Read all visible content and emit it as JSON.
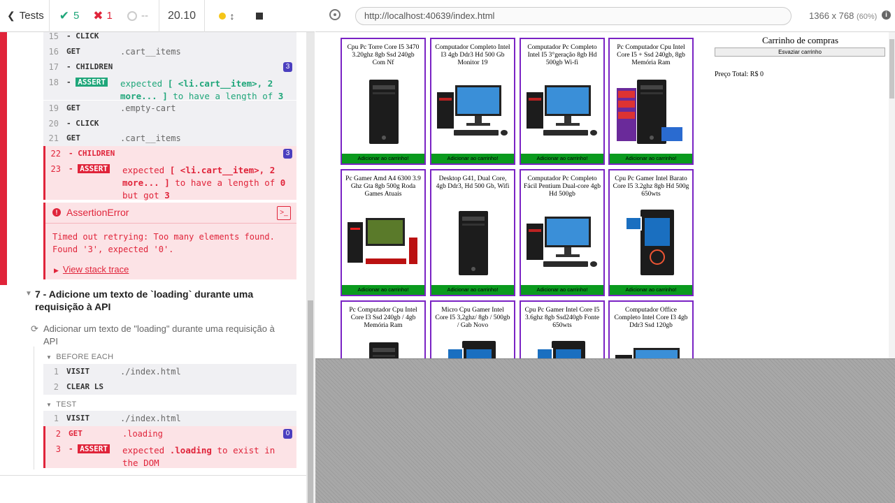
{
  "reporter": {
    "tests_label": "Tests",
    "passed": "5",
    "failed": "1",
    "pending": "--",
    "duration": "20.10"
  },
  "commands": [
    {
      "n": "15",
      "cmd": "- CLICK",
      "arg": ""
    },
    {
      "n": "16",
      "cmd": "GET",
      "arg": ".cart__items"
    },
    {
      "n": "17",
      "cmd": "- CHILDREN",
      "arg": "",
      "badge": "3"
    },
    {
      "n": "18",
      "cmd": "- ASSERT",
      "msg_pre": "expected",
      "msg_b": "[ <li.cart__item>, 2 more... ]",
      "msg_mid": "to have a length of",
      "msg_val": "3"
    },
    {
      "n": "19",
      "cmd": "GET",
      "arg": ".empty-cart"
    },
    {
      "n": "20",
      "cmd": "- CLICK",
      "arg": ""
    },
    {
      "n": "21",
      "cmd": "GET",
      "arg": ".cart__items"
    },
    {
      "n": "22",
      "cmd": "- CHILDREN",
      "arg": "",
      "badge": "3"
    },
    {
      "n": "23",
      "cmd": "- ASSERT",
      "msg_pre": "expected",
      "msg_b": "[ <li.cart__item>, 2 more... ]",
      "msg_mid": "to have a length of",
      "msg_val": "0",
      "msg_tail": "but got",
      "msg_got": "3"
    }
  ],
  "error": {
    "title": "AssertionError",
    "text": "Timed out retrying: Too many elements found. Found '3', expected '0'.",
    "stack_link": "View stack trace"
  },
  "suite7": {
    "title": "7 - Adicione um texto de `loading` durante uma requisição à API",
    "test": "Adicionar um texto de \"loading\" durante uma requisição à API",
    "before_each": "BEFORE EACH",
    "test_label": "TEST",
    "before": [
      {
        "n": "1",
        "cmd": "VISIT",
        "arg": "./index.html"
      },
      {
        "n": "2",
        "cmd": "CLEAR LS",
        "arg": ""
      }
    ],
    "steps": [
      {
        "n": "1",
        "cmd": "VISIT",
        "arg": "./index.html"
      },
      {
        "n": "2",
        "cmd": "GET",
        "arg": ".loading",
        "badge": "0"
      },
      {
        "n": "3",
        "cmd": "- ASSERT",
        "msg_pre": "expected",
        "msg_b": ".loading",
        "msg_mid": "to exist in the DOM"
      }
    ]
  },
  "browser": {
    "url": "http://localhost:40639/index.html",
    "viewport": "1366 x 768",
    "zoom": "(60%)"
  },
  "products": [
    {
      "title": "Cpu Pc Torre Core I5 3470 3.20ghz 8gb Ssd 240gb Com Nf",
      "icon": "tower"
    },
    {
      "title": "Computador Completo Intel I3 4gb Ddr3 Hd 500 Gb Monitor 19",
      "icon": "desktop-set"
    },
    {
      "title": "Computador Pc Completo Intel I5 3°geração 8gb Hd 500gb Wi-fi",
      "icon": "desktop-set"
    },
    {
      "title": "Pc Computador Cpu Intel Core I5 + Ssd 240gb, 8gb Memória Ram",
      "icon": "tower-specs"
    },
    {
      "title": "Pc Gamer Amd A4 6300 3.9 Ghz Gta 8gb 500g Roda Games Atuais",
      "icon": "gamer-set"
    },
    {
      "title": "Desktop G41, Dual Core, 4gb Ddr3, Hd 500 Gb, Wifi",
      "icon": "tower"
    },
    {
      "title": "Computador Pc Completo Fácil Pentium Dual-core 4gb Hd 500gb",
      "icon": "desktop-set"
    },
    {
      "title": "Cpu Pc Gamer Intel Barato Core I5 3.2ghz 8gb Hd 500g 650wts",
      "icon": "gamer-tower"
    },
    {
      "title": "Pc Computador Cpu Intel Core I3 Ssd 240gb / 4gb Memória Ram",
      "icon": "tower"
    },
    {
      "title": "Micro Cpu Gamer Intel Core I5 3,2ghz/ 8gb / 500gb / Gab Novo",
      "icon": "gamer-tower"
    },
    {
      "title": "Cpu Pc Gamer Intel Core I5 3.6ghz 8gb Ssd240gb Fonte 650wts",
      "icon": "gamer-tower"
    },
    {
      "title": "Computador Office Completo Intel Core I3 4gb Ddr3 Ssd 120gb",
      "icon": "desktop-set"
    }
  ],
  "add_label": "Adicionar ao carrinho!",
  "cart": {
    "title": "Carrinho de compras",
    "empty_label": "Esvaziar carrinho",
    "total": "Preço Total: R$ 0"
  },
  "colors": {
    "fail": "#e0243a",
    "pass": "#1fa67a",
    "card_border": "#7a23c4",
    "add_button": "#0a9a1e"
  }
}
